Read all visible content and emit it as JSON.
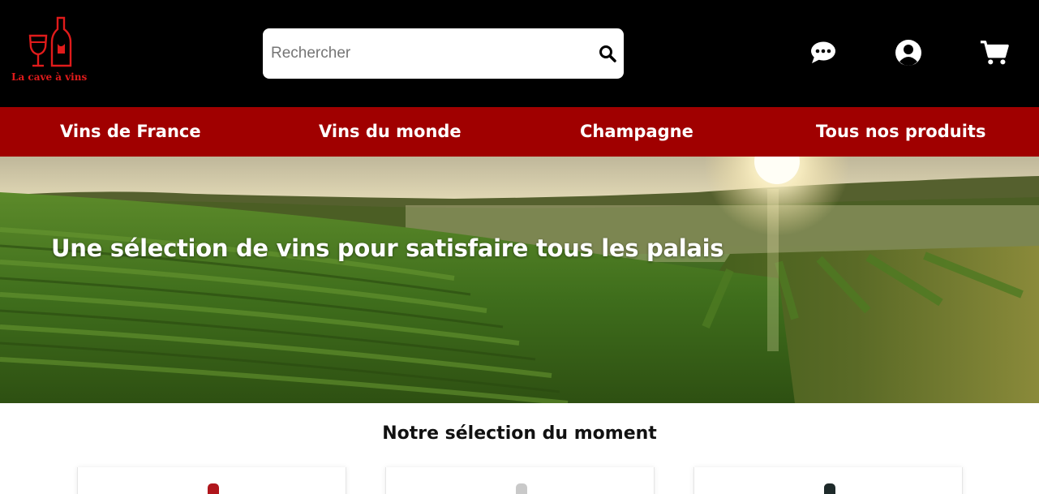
{
  "header": {
    "logo_text": "La cave à vins",
    "search": {
      "placeholder": "Rechercher",
      "value": ""
    },
    "icons": [
      "chat-icon",
      "user-icon",
      "cart-icon"
    ]
  },
  "nav": {
    "items": [
      {
        "label": "Vins de France"
      },
      {
        "label": "Vins du monde"
      },
      {
        "label": "Champagne"
      },
      {
        "label": "Tous nos produits"
      }
    ]
  },
  "hero": {
    "title": "Une sélection de vins pour satisfaire tous les palais"
  },
  "selection": {
    "title": "Notre sélection du moment",
    "products": [
      {
        "cap_color": "#b0161c"
      },
      {
        "cap_color": "#c9c9c9"
      },
      {
        "cap_color": "#1e2a2a"
      }
    ]
  },
  "colors": {
    "header_bg": "#000000",
    "nav_bg": "#a00000",
    "logo_red": "#e01b1b"
  }
}
